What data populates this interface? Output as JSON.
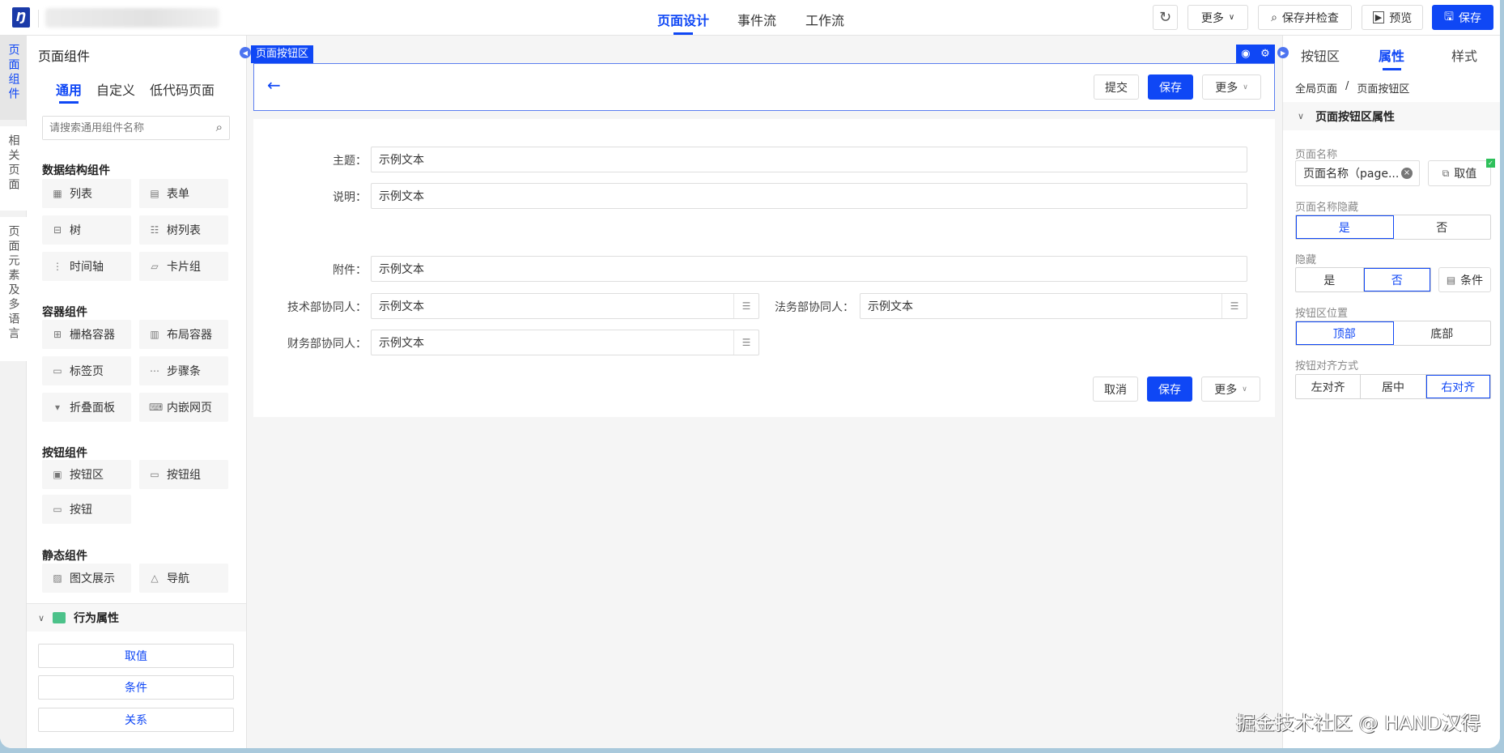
{
  "topbar": {
    "tabs": [
      "页面设计",
      "事件流",
      "工作流"
    ],
    "more_label": "更多",
    "save_check_label": "保存并检查",
    "preview_label": "预览",
    "save_label": "保存"
  },
  "side_tabs": [
    "页面组件",
    "相关页面",
    "页面元素及多语言"
  ],
  "left_panel": {
    "title": "页面组件",
    "tabs": [
      "通用",
      "自定义",
      "低代码页面"
    ],
    "search_placeholder": "请搜索通用组件名称",
    "sections": [
      {
        "title": "数据结构组件",
        "items": [
          {
            "label": "列表",
            "icon": "table-icon"
          },
          {
            "label": "表单",
            "icon": "form-icon"
          },
          {
            "label": "树",
            "icon": "tree-icon"
          },
          {
            "label": "树列表",
            "icon": "tree-table-icon"
          },
          {
            "label": "时间轴",
            "icon": "timeline-icon"
          },
          {
            "label": "卡片组",
            "icon": "card-group-icon"
          }
        ]
      },
      {
        "title": "容器组件",
        "items": [
          {
            "label": "栅格容器",
            "icon": "grid-icon"
          },
          {
            "label": "布局容器",
            "icon": "layout-icon"
          },
          {
            "label": "标签页",
            "icon": "tab-icon"
          },
          {
            "label": "步骤条",
            "icon": "steps-icon"
          },
          {
            "label": "折叠面板",
            "icon": "collapse-icon"
          },
          {
            "label": "内嵌网页",
            "icon": "iframe-icon"
          }
        ]
      },
      {
        "title": "按钮组件",
        "items": [
          {
            "label": "按钮区",
            "icon": "button-area-icon"
          },
          {
            "label": "按钮组",
            "icon": "button-group-icon"
          },
          {
            "label": "按钮",
            "icon": "button-icon"
          }
        ]
      },
      {
        "title": "静态组件",
        "items": [
          {
            "label": "图文展示",
            "icon": "image-text-icon"
          },
          {
            "label": "导航",
            "icon": "navigation-icon"
          }
        ]
      }
    ],
    "behavior_title": "行为属性",
    "behavior_buttons": [
      "取值",
      "条件",
      "关系"
    ]
  },
  "canvas": {
    "area_tag": "页面按钮区",
    "top_buttons": {
      "submit": "提交",
      "save": "保存",
      "more": "更多"
    },
    "fields": {
      "subject": {
        "label": "主题：",
        "value": "示例文本"
      },
      "desc": {
        "label": "说明：",
        "value": "示例文本"
      },
      "attach": {
        "label": "附件：",
        "value": "示例文本"
      },
      "tech": {
        "label": "技术部协同人：",
        "value": "示例文本"
      },
      "legal": {
        "label": "法务部协同人：",
        "value": "示例文本"
      },
      "finance": {
        "label": "财务部协同人：",
        "value": "示例文本"
      }
    },
    "bottom_buttons": {
      "cancel": "取消",
      "save": "保存",
      "more": "更多"
    }
  },
  "right_panel": {
    "tabs": [
      "按钮区",
      "属性",
      "样式"
    ],
    "breadcrumb": [
      "全局页面",
      "/",
      "页面按钮区"
    ],
    "section_title": "页面按钮区属性",
    "page_name_label": "页面名称",
    "page_name_value": "页面名称（page...",
    "fetch_label": "取值",
    "name_hidden_label": "页面名称隐藏",
    "name_hidden_options": [
      "是",
      "否"
    ],
    "hidden_label": "隐藏",
    "hidden_options": [
      "是",
      "否"
    ],
    "condition_label": "条件",
    "position_label": "按钮区位置",
    "position_options": [
      "顶部",
      "底部"
    ],
    "align_label": "按钮对齐方式",
    "align_options": [
      "左对齐",
      "居中",
      "右对齐"
    ]
  },
  "watermark": "掘金技术社区 @ HAND汉得"
}
